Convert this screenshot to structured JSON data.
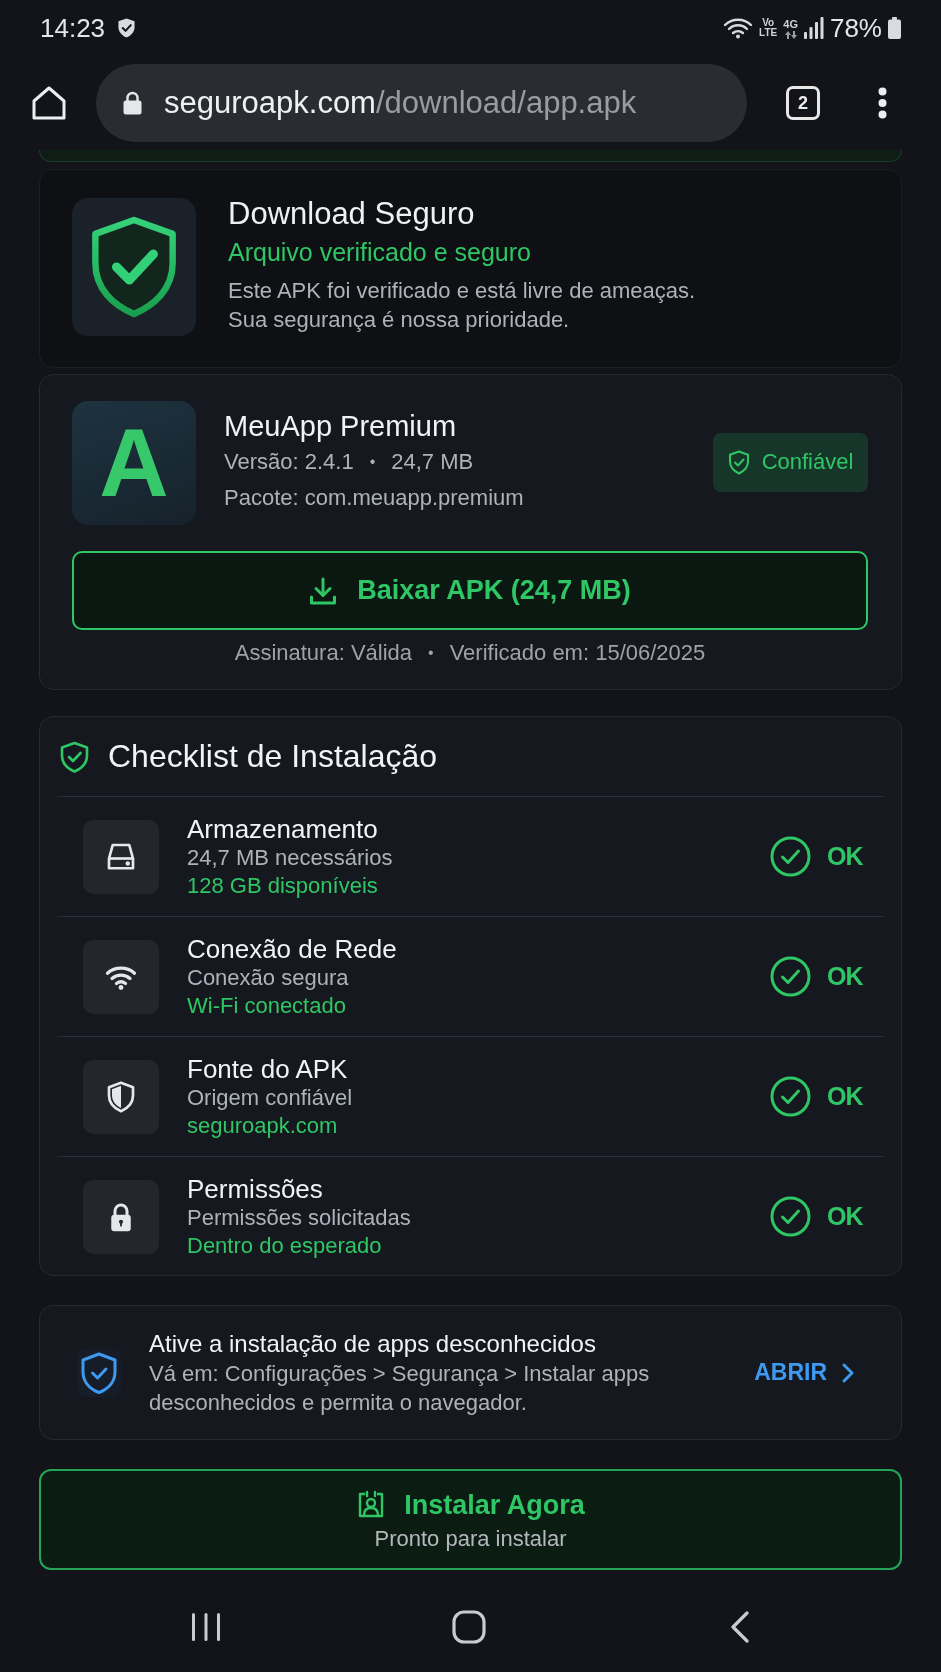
{
  "status_bar": {
    "time": "14:23",
    "volte": [
      "Vo",
      "LTE"
    ],
    "network_type": "4G",
    "battery": "78%"
  },
  "browser": {
    "url_host": "seguroapk.com",
    "url_path": "/download/app.apk",
    "tab_count": "2"
  },
  "security_card": {
    "title": "Download Seguro",
    "subtitle": "Arquivo verificado e seguro",
    "lines": [
      "Este APK foi verificado e está livre de ameaças.",
      "Sua segurança é nossa prioridade."
    ]
  },
  "app_card": {
    "logo_letter": "A",
    "name": "MeuApp Premium",
    "meta": [
      "Versão: 2.4.1",
      "24,7 MB"
    ],
    "meta_separator": "•",
    "package": "Pacote: com.meuapp.premium",
    "badge": "Confiável",
    "download_button": "Baixar APK (24,7 MB)",
    "footer": [
      "Assinatura: Válida",
      "Verificado em: 15/06/2025"
    ],
    "footer_separator": "•"
  },
  "checklist": {
    "title": "Checklist de Instalação",
    "items": [
      {
        "kind": "storage",
        "title": "Armazenamento",
        "detail": "24,7 MB necessários",
        "status_text": "128 GB disponíveis",
        "passed": true,
        "result": "OK"
      },
      {
        "kind": "network",
        "title": "Conexão de Rede",
        "detail": "Conexão segura",
        "status_text": "Wi-Fi conectado",
        "passed": true,
        "result": "OK"
      },
      {
        "kind": "source",
        "title": "Fonte do APK",
        "detail": "Origem confiável",
        "status_text": "seguroapk.com",
        "passed": true,
        "result": "OK"
      },
      {
        "kind": "permissions",
        "title": "Permissões",
        "detail": "Permissões solicitadas",
        "status_text": "Dentro do esperado",
        "passed": true,
        "result": "OK"
      }
    ]
  },
  "notice": {
    "title": "Ative a instalação de apps desconhecidos",
    "description": "Vá em: Configurações > Segurança > Instalar apps desconhecidos e permita o navegador.",
    "action": "ABRIR"
  },
  "install_button": {
    "label": "Instalar Agora",
    "subtitle": "Pronto para instalar"
  }
}
